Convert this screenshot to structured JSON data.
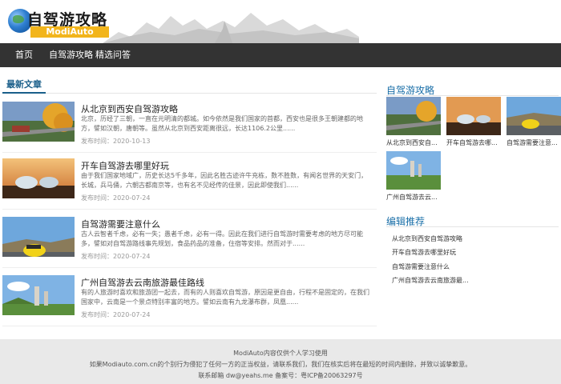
{
  "header": {
    "logo_title": "自驾游攻略",
    "logo_sub": "ModiAuto"
  },
  "nav": {
    "items": [
      {
        "label": "首页"
      },
      {
        "label": "自驾游攻略"
      },
      {
        "label": "精选问答"
      }
    ]
  },
  "main": {
    "section_title": "最新文章",
    "articles": [
      {
        "title": "从北京到西安自驾游攻略",
        "desc": "北京，历经了三朝，一直在元明清的都城。如今依然是我们国家的首都，西安也是很多王朝建都的地方，譬如汉朝，唐朝等。虽然从北京到西安距离很远，长达1106.2公里......",
        "date": "发布时间：2020-10-13"
      },
      {
        "title": "开车自驾游去哪里好玩",
        "desc": "由于我们国家地域广，历史长达5千多年，因此名胜古迹许牛充栋，数不胜数，有闻名世界的天安门，长城，兵马俑，六朝古都南京等，也有名不见经传的佳景，因此即使我们......",
        "date": "发布时间：2020-07-24"
      },
      {
        "title": "自驾游需要注意什么",
        "desc": "古人云智者千虑，必有一失；愚者千虑，必有一得。因此在我们进行自驾游时需要考虑的地方尽可能多，譬如对自驾游路线事先规划，食品药品的准备，住宿等安排。然而对于......",
        "date": "发布时间：2020-07-24"
      },
      {
        "title": "广州自驾游去云南旅游最佳路线",
        "desc": "有的人旅游时喜欢和旅游团一起去，而有的人则喜欢自驾游，原因是更自由，行程不是固定的，在我们国家中，云南是一个景点特别丰富的地方。譬如云南有九龙瀑布群，凤凰......",
        "date": "发布时间：2020-07-24"
      }
    ]
  },
  "sidebar": {
    "section1_title": "自驾游攻略",
    "grid": [
      {
        "caption": "从北京到西安自..."
      },
      {
        "caption": "开车自驾游去哪..."
      },
      {
        "caption": "自驾游需要注意..."
      },
      {
        "caption": "广州自驾游去云..."
      }
    ],
    "section2_title": "编辑推荐",
    "recommend": [
      {
        "label": "从北京到西安自驾游攻略"
      },
      {
        "label": "开车自驾游去哪里好玩"
      },
      {
        "label": "自驾游需要注意什么"
      },
      {
        "label": "广州自驾游去云南旅游最..."
      }
    ]
  },
  "footer": {
    "line1": "ModiAuto内容仅供个人学习使用",
    "line2": "如果Modiauto.com.cn的个别行为侵犯了任何一方的正当权益，请联系我们，我们在核实后将在最短的时间内删除，并致以诚挚歉意。",
    "line3": "联系邮箱 dw@yeahs.me 备案号：粤ICP备20063297号"
  },
  "colors": {
    "nav_bg": "#333333",
    "accent": "#1a6fa8",
    "logo_badge": "#f2b51c",
    "footer_bg": "#e9e9e9"
  }
}
